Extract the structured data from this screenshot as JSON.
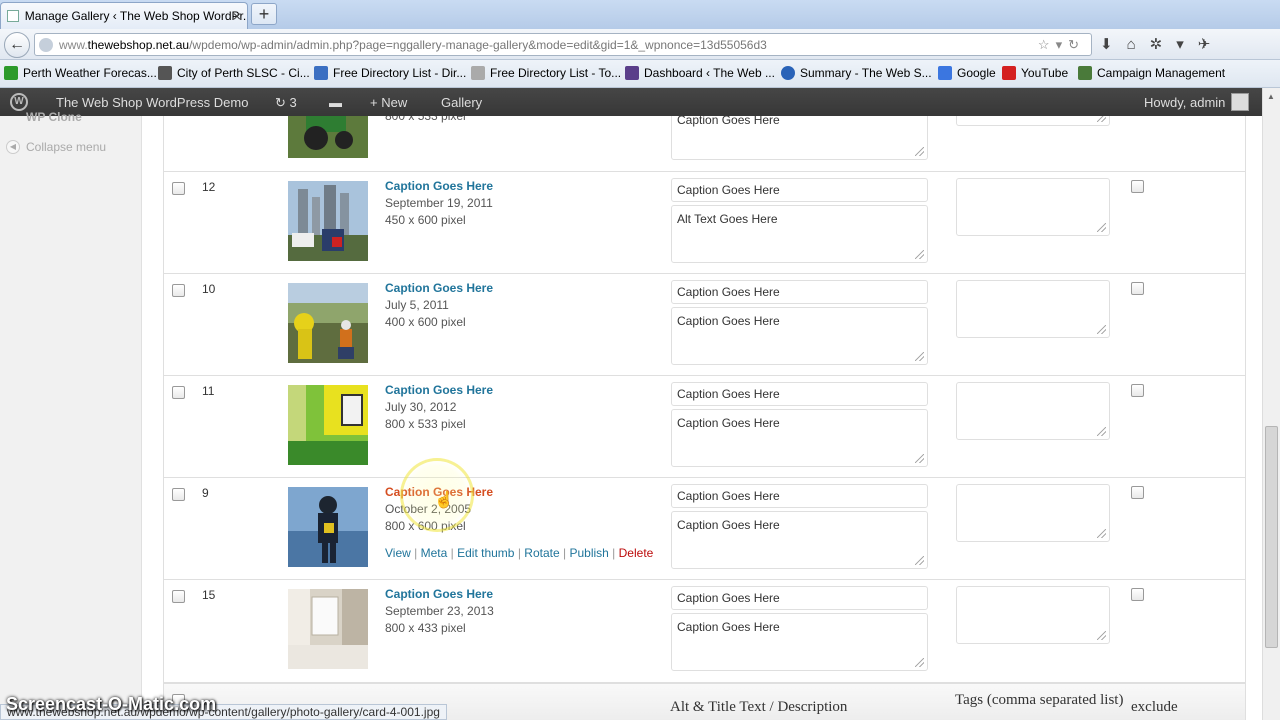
{
  "browser": {
    "tab_title": "Manage Gallery ‹ The Web Shop WordPr...",
    "tab_close": "×",
    "new_tab": "+",
    "url_prefix": "www.",
    "url_host": "thewebshop.net.au",
    "url_path": "/wpdemo/wp-admin/admin.php?page=nggallery-manage-gallery&mode=edit&gid=1&_wpnonce=13d55056d3"
  },
  "bookmarks": [
    {
      "label": "Perth Weather Forecas...",
      "icon": "arrow-green-icon",
      "color": "#2c9a2c"
    },
    {
      "label": "City of Perth SLSC - Ci...",
      "icon": "club-icon",
      "color": "#555555"
    },
    {
      "label": "Free Directory List - Dir...",
      "icon": "doc-icon",
      "color": "#3b6fc2"
    },
    {
      "label": "Free Directory List - To...",
      "icon": "pin-icon",
      "color": "#888888"
    },
    {
      "label": "Dashboard ‹ The Web ...",
      "icon": "w-icon",
      "color": "#5a3e8a"
    },
    {
      "label": "Summary - The Web S...",
      "icon": "globe-icon",
      "color": "#2a63b8"
    },
    {
      "label": "Google",
      "icon": "google-icon",
      "color": "#3b76e0"
    },
    {
      "label": "YouTube",
      "icon": "youtube-icon",
      "color": "#d42020"
    },
    {
      "label": "Campaign Management",
      "icon": "g-icon",
      "color": "#4a7a3a"
    }
  ],
  "adminbar": {
    "site_name": "The Web Shop WordPress Demo",
    "updates_count": "3",
    "new_label": "New",
    "gallery_label": "Gallery",
    "howdy": "Howdy, admin"
  },
  "menu": {
    "collapse_label": "Collapse menu",
    "top_fragment": "WP Clone"
  },
  "rows": [
    {
      "id": "12",
      "caption": "Caption Goes Here",
      "date": "September 19, 2011",
      "dims": "450 x 600 pixel",
      "title": "Caption Goes Here",
      "desc": "Alt Text Goes Here"
    },
    {
      "id": "10",
      "caption": "Caption Goes Here",
      "date": "July 5, 2011",
      "dims": "400 x 600 pixel",
      "title": "Caption Goes Here",
      "desc": "Caption Goes Here"
    },
    {
      "id": "11",
      "caption": "Caption Goes Here",
      "date": "July 30, 2012",
      "dims": "800 x 533 pixel",
      "title": "Caption Goes Here",
      "desc": "Caption Goes Here"
    },
    {
      "id": "9",
      "caption": "Caption Goes Here",
      "date": "October 2, 2005",
      "dims": "800 x 600 pixel",
      "title": "Caption Goes Here",
      "desc": "Caption Goes Here"
    },
    {
      "id": "15",
      "caption": "Caption Goes Here",
      "date": "September 23, 2013",
      "dims": "800 x 433 pixel",
      "title": "Caption Goes Here",
      "desc": "Caption Goes Here"
    }
  ],
  "partial_row": {
    "dims": "800 x 533 pixel",
    "desc": "Caption Goes Here"
  },
  "row_actions": {
    "view": "View",
    "meta": "Meta",
    "edit_thumb": "Edit thumb",
    "rotate": "Rotate",
    "publish": "Publish",
    "delete": "Delete",
    "sep": "|"
  },
  "footer": {
    "alt_title": "Alt & Title Text / Description",
    "tags": "Tags (comma separated list)",
    "exclude": "exclude"
  },
  "status_url": "www.thewebshop.net.au/wpdemo/wp-content/gallery/photo-gallery/card-4-001.jpg",
  "watermark": "Screencast-O-Matic.com"
}
